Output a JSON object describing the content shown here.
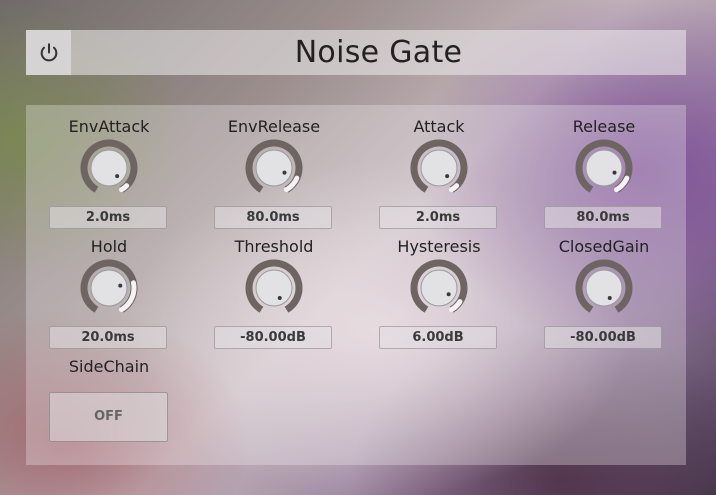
{
  "header": {
    "title": "Noise Gate",
    "power_icon": "power-icon"
  },
  "params": [
    {
      "id": "envattack",
      "label": "EnvAttack",
      "value": "2.0ms",
      "level": 0.05
    },
    {
      "id": "envrelease",
      "label": "EnvRelease",
      "value": "80.0ms",
      "level": 0.12
    },
    {
      "id": "attack",
      "label": "Attack",
      "value": "2.0ms",
      "level": 0.05
    },
    {
      "id": "release",
      "label": "Release",
      "value": "80.0ms",
      "level": 0.12
    },
    {
      "id": "hold",
      "label": "Hold",
      "value": "20.0ms",
      "level": 0.24
    },
    {
      "id": "threshold",
      "label": "Threshold",
      "value": "-80.00dB",
      "level": 0.0
    },
    {
      "id": "hysteresis",
      "label": "Hysteresis",
      "value": "6.00dB",
      "level": 0.09
    },
    {
      "id": "closedgain",
      "label": "ClosedGain",
      "value": "-80.00dB",
      "level": 0.0
    }
  ],
  "sidechain": {
    "label": "SideChain",
    "state": "OFF"
  },
  "colors": {
    "knob_track": "#6e6462",
    "knob_fill": "#f4f2f4",
    "knob_face": "#e2e2e4",
    "indicator": "#3a3a3a"
  }
}
